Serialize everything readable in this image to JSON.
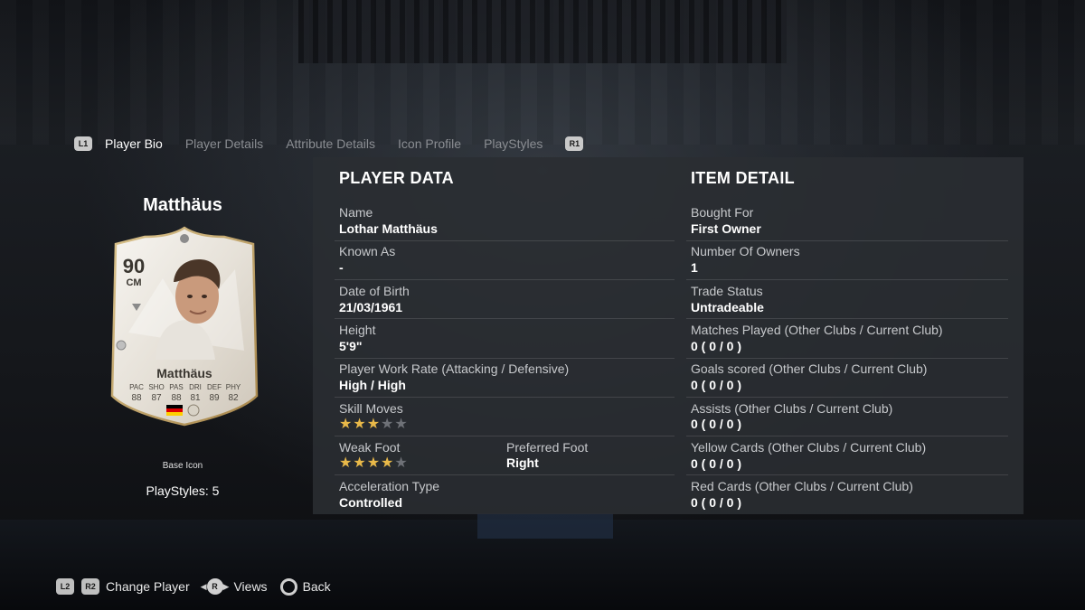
{
  "tabs": {
    "left_shoulder": "L1",
    "right_shoulder": "R1",
    "items": [
      "Player Bio",
      "Player Details",
      "Attribute Details",
      "Icon Profile",
      "PlayStyles"
    ]
  },
  "player": {
    "display_name": "Matthäus",
    "card_type": "Base Icon",
    "playstyles_label": "PlayStyles: 5"
  },
  "card": {
    "rating": "90",
    "position": "CM",
    "name": "Matthäus",
    "stat_labels": [
      "PAC",
      "SHO",
      "PAS",
      "DRI",
      "DEF",
      "PHY"
    ],
    "stat_values": [
      "88",
      "87",
      "88",
      "81",
      "89",
      "82"
    ]
  },
  "player_data": {
    "heading": "PLAYER DATA",
    "name_label": "Name",
    "name_value": "Lothar Matthäus",
    "known_as_label": "Known As",
    "known_as_value": "-",
    "dob_label": "Date of Birth",
    "dob_value": "21/03/1961",
    "height_label": "Height",
    "height_value": "5'9\"",
    "work_rate_label": "Player Work Rate (Attacking / Defensive)",
    "work_rate_value": "High / High",
    "skill_moves_label": "Skill Moves",
    "skill_moves_rating": 3,
    "weak_foot_label": "Weak Foot",
    "weak_foot_rating": 4,
    "preferred_foot_label": "Preferred Foot",
    "preferred_foot_value": "Right",
    "accel_label": "Acceleration Type",
    "accel_value": "Controlled"
  },
  "item_detail": {
    "heading": "ITEM DETAIL",
    "bought_for_label": "Bought For",
    "bought_for_value": "First Owner",
    "owners_label": "Number Of Owners",
    "owners_value": "1",
    "trade_label": "Trade Status",
    "trade_value": "Untradeable",
    "matches_label": "Matches Played (Other Clubs / Current Club)",
    "matches_value": "0 ( 0 / 0 )",
    "goals_label": "Goals scored (Other Clubs / Current Club)",
    "goals_value": "0 ( 0 / 0 )",
    "assists_label": "Assists (Other Clubs / Current Club)",
    "assists_value": "0 ( 0 / 0 )",
    "yellow_label": "Yellow Cards (Other Clubs / Current Club)",
    "yellow_value": "0 ( 0 / 0 )",
    "red_label": "Red Cards (Other Clubs / Current Club)",
    "red_value": "0 ( 0 / 0 )"
  },
  "controls": {
    "l2": "L2",
    "r2": "R2",
    "change_player": "Change Player",
    "r_stick": "R",
    "views": "Views",
    "back": "Back"
  },
  "colors": {
    "star_on": "#e9b949",
    "star_off": "#6e7177",
    "panel": "#2a2d32"
  }
}
